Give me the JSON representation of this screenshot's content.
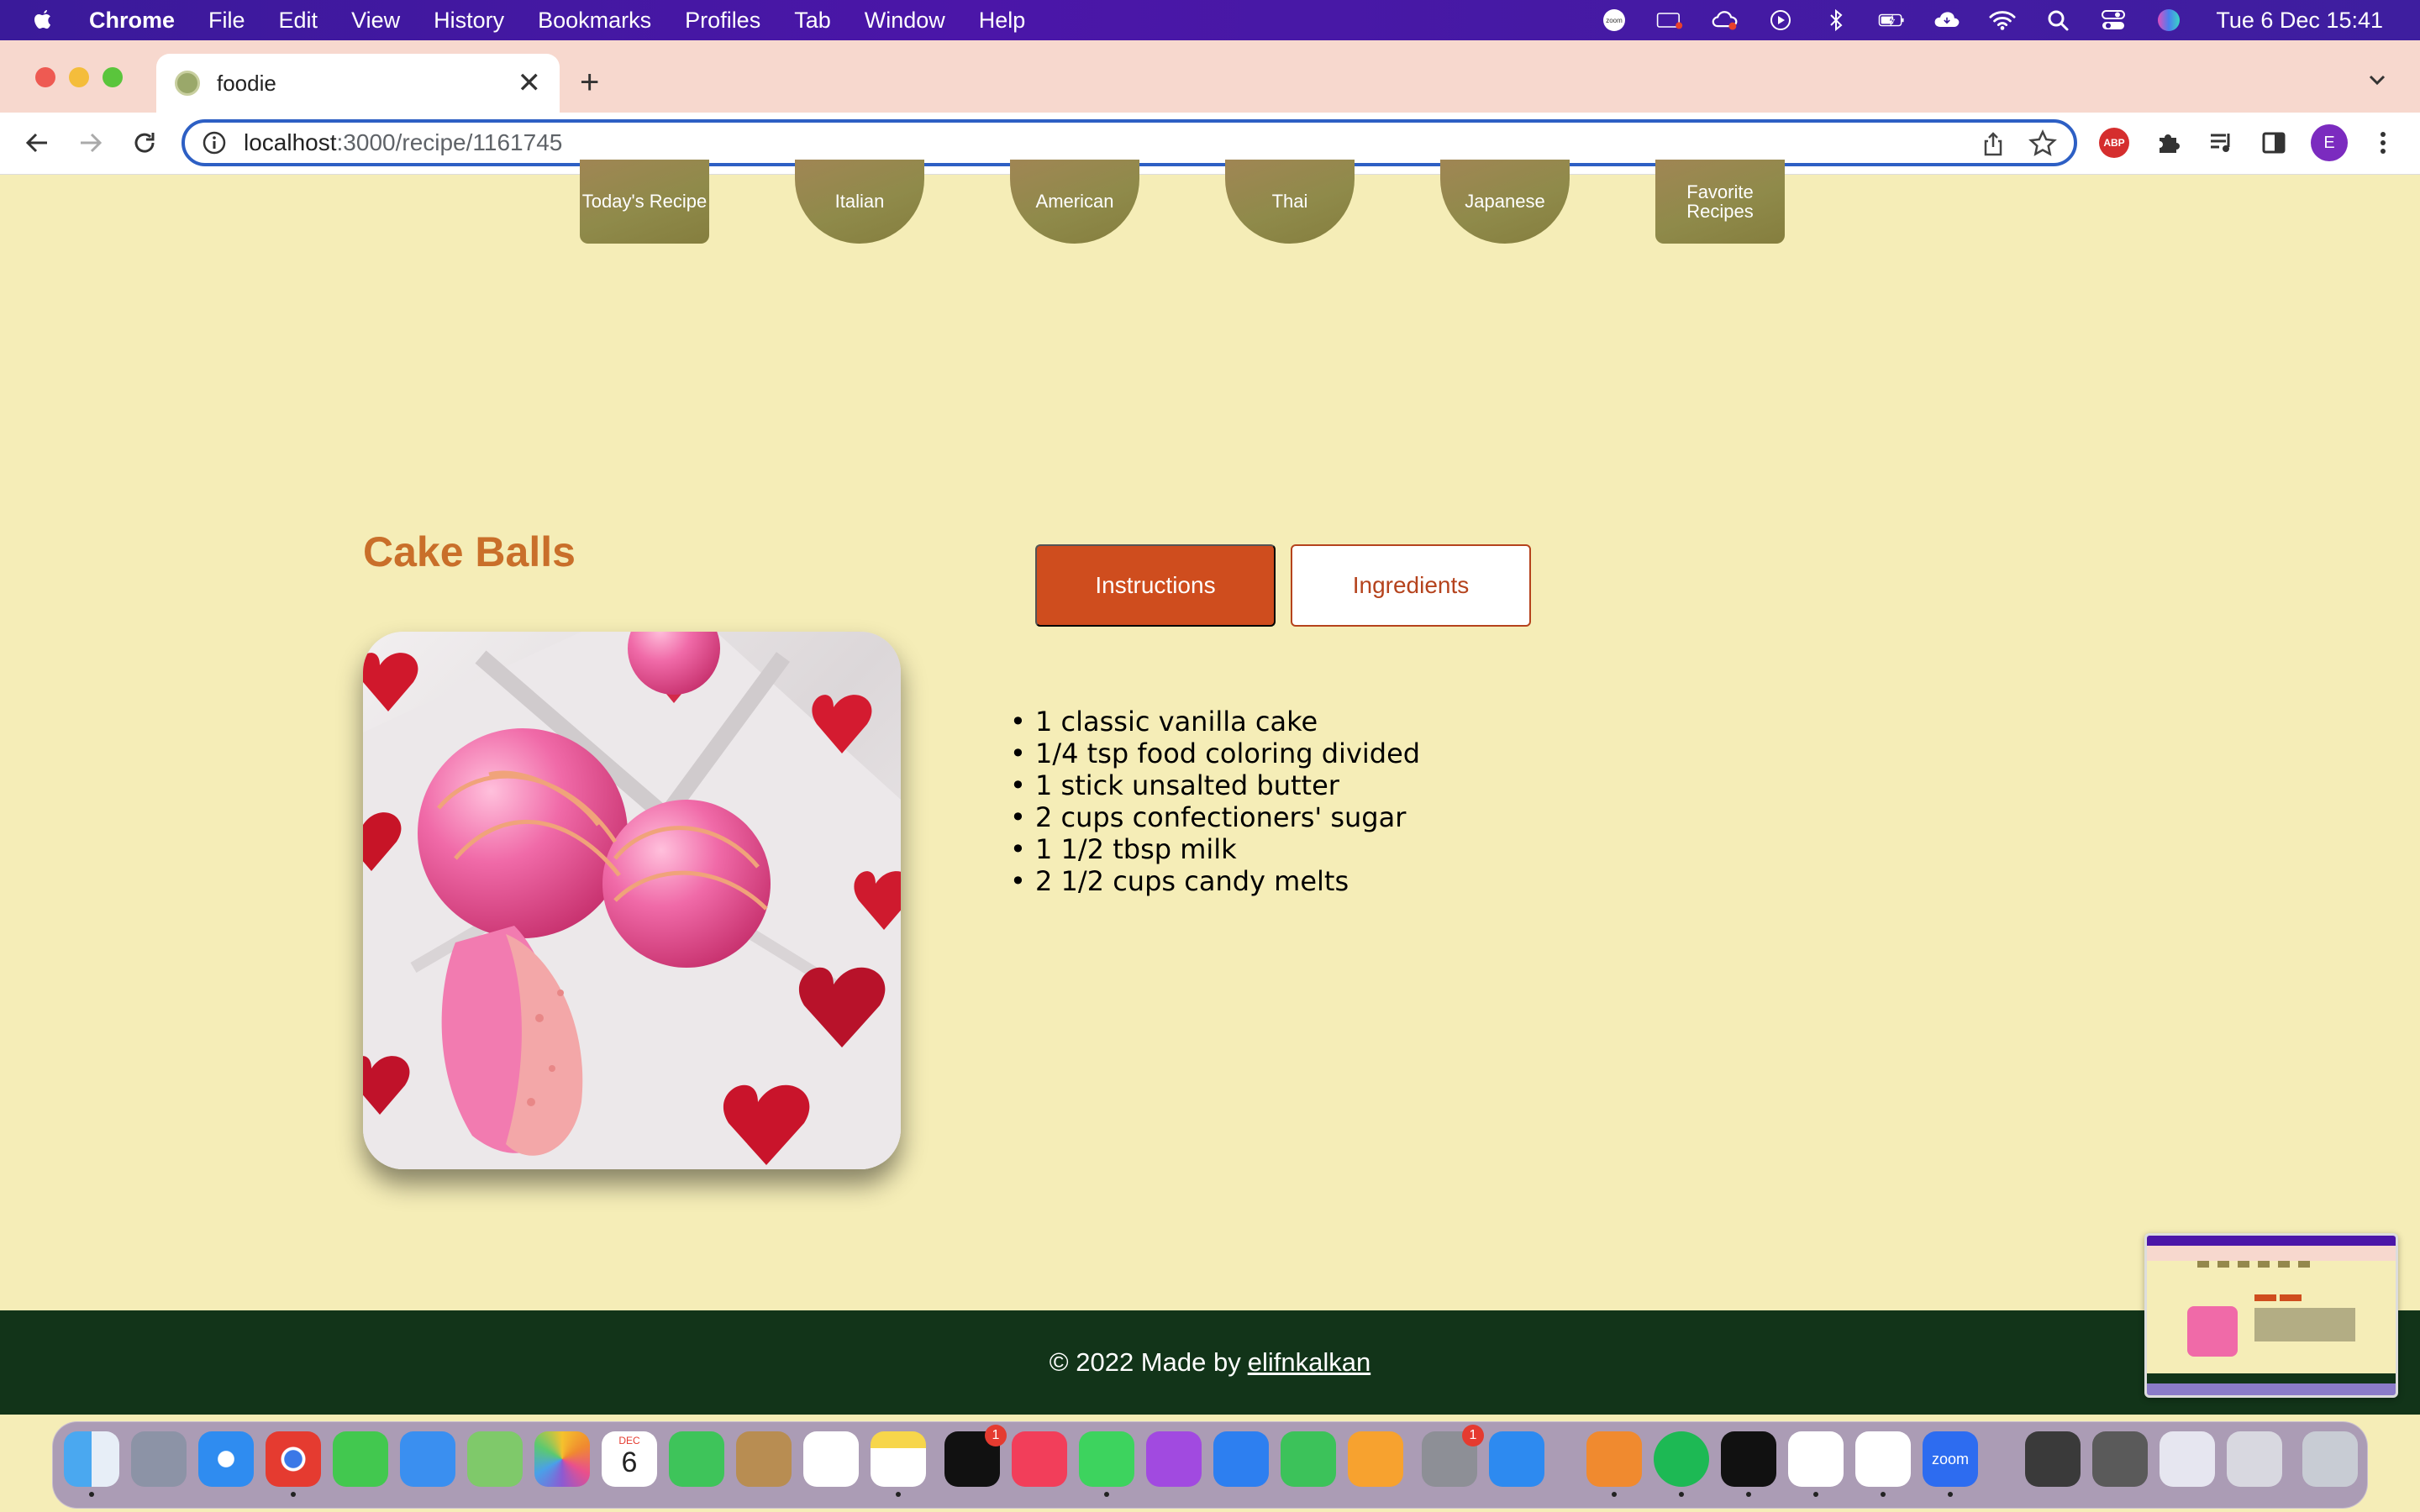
{
  "menubar": {
    "app_name": "Chrome",
    "menus": [
      "File",
      "Edit",
      "View",
      "History",
      "Bookmarks",
      "Profiles",
      "Tab",
      "Window",
      "Help"
    ],
    "status_icons": [
      "zoom-status-icon",
      "screen-recorder-icon",
      "creative-cloud-icon",
      "play-circle-icon",
      "bluetooth-icon",
      "battery-icon",
      "cloud-icon",
      "wifi-icon",
      "spotlight-search-icon",
      "control-center-icon",
      "siri-icon"
    ],
    "zoom_label": "zoom",
    "datetime": "Tue 6 Dec  15:41"
  },
  "browser": {
    "tab_title": "foodie",
    "url_host": "localhost",
    "url_path": ":3000/recipe/1161745",
    "profile_initial": "E",
    "abp_label": "ABP"
  },
  "nav": {
    "items": [
      "Today's Recipe",
      "Italian",
      "American",
      "Thai",
      "Japanese",
      "Favorite Recipes"
    ]
  },
  "recipe": {
    "title": "Cake Balls",
    "instructions_label": "Instructions",
    "ingredients_label": "Ingredients",
    "ingredients": [
      "1 classic vanilla cake",
      "1/4 tsp food coloring divided",
      "1 stick unsalted butter",
      "2 cups confectioners' sugar",
      "1 1/2 tbsp milk",
      "2 1/2 cups candy melts"
    ]
  },
  "footer": {
    "prefix": "© 2022 Made by",
    "author": "elifnkalkan"
  },
  "dock": {
    "calendar_month": "DEC",
    "calendar_day": "6",
    "tv_badge": "1",
    "settings_badge": "1",
    "zoom_label": "zoom"
  },
  "colors": {
    "page_bg": "#f5edb7",
    "accent": "#cf4d1e",
    "title": "#c96f2a",
    "footer_bg": "#123419"
  }
}
